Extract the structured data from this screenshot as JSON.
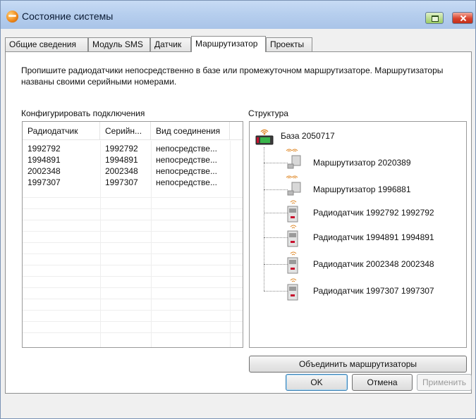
{
  "window": {
    "title": "Состояние системы"
  },
  "tabs": [
    {
      "label": "Общие сведения"
    },
    {
      "label": "Модуль SMS"
    },
    {
      "label": "Датчик"
    },
    {
      "label": "Маршрутизатор"
    },
    {
      "label": "Проекты"
    }
  ],
  "active_tab": "Маршрутизатор",
  "description": "Пропишите радиодатчики непосредственно в базе или промежуточном маршрутизаторе. Маршрутизаторы названы своими серийными номерами.",
  "connections": {
    "label": "Конфигурировать подключения",
    "columns": [
      "Радиодатчик",
      "Серийн...",
      "Вид соединения"
    ],
    "rows": [
      [
        "1992792",
        "1992792",
        "непосредстве..."
      ],
      [
        "1994891",
        "1994891",
        "непосредстве..."
      ],
      [
        "2002348",
        "2002348",
        "непосредстве..."
      ],
      [
        "1997307",
        "1997307",
        "непосредстве..."
      ]
    ]
  },
  "structure": {
    "label": "Структура",
    "root": "База 2050717",
    "children": [
      {
        "label": "Маршрутизатор 2020389",
        "icon": "router-icon"
      },
      {
        "label": "Маршрутизатор 1996881",
        "icon": "router-icon"
      },
      {
        "label": "Радиодатчик 1992792 1992792",
        "icon": "radio-sensor-icon"
      },
      {
        "label": "Радиодатчик 1994891 1994891",
        "icon": "radio-sensor-icon"
      },
      {
        "label": "Радиодатчик 2002348 2002348",
        "icon": "radio-sensor-icon"
      },
      {
        "label": "Радиодатчик 1997307 1997307",
        "icon": "radio-sensor-icon"
      }
    ]
  },
  "buttons": {
    "merge": "Объединить маршрутизаторы",
    "ok": "OK",
    "cancel": "Отмена",
    "apply": "Применить"
  }
}
